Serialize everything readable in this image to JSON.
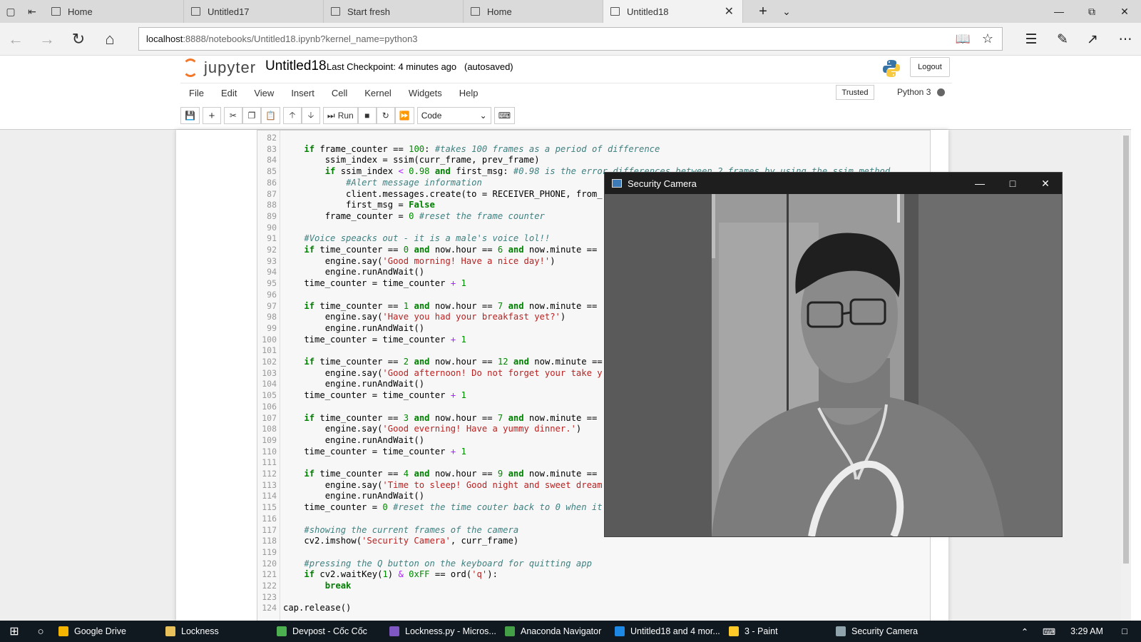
{
  "browser": {
    "tabs": [
      {
        "label": "Home"
      },
      {
        "label": "Untitled17"
      },
      {
        "label": "Start fresh"
      },
      {
        "label": "Home"
      },
      {
        "label": "Untitled18",
        "active": true
      }
    ],
    "url_host": "localhost",
    "url_rest": ":8888/notebooks/Untitled18.ipynb?kernel_name=python3"
  },
  "jupyter": {
    "logo_text": "jupyter",
    "notebook_name": "Untitled18",
    "checkpoint_label": "Last Checkpoint:",
    "checkpoint_time": "4 minutes ago",
    "autosave": "(autosaved)",
    "logout_label": "Logout",
    "menu": [
      "File",
      "Edit",
      "View",
      "Insert",
      "Cell",
      "Kernel",
      "Widgets",
      "Help"
    ],
    "trusted_label": "Trusted",
    "kernel_name": "Python 3",
    "run_label": "Run",
    "cell_type": "Code"
  },
  "code_lines": [
    {
      "n": "82",
      "t": ""
    },
    {
      "n": "83",
      "t": "    if frame_counter == 100: #takes 100 frames as a period of difference"
    },
    {
      "n": "84",
      "t": "        ssim_index = ssim(curr_frame, prev_frame)"
    },
    {
      "n": "85",
      "t": "        if ssim_index < 0.98 and first_msg: #0.98 is the error differences between 2 frames by using the ssim method"
    },
    {
      "n": "86",
      "t": "            #Alert message information"
    },
    {
      "n": "87",
      "t": "            client.messages.create(to = RECEIVER_PHONE, from_"
    },
    {
      "n": "88",
      "t": "            first_msg = False"
    },
    {
      "n": "89",
      "t": "        frame_counter = 0 #reset the frame counter"
    },
    {
      "n": "90",
      "t": ""
    },
    {
      "n": "91",
      "t": "    #Voice speacks out - it is a male's voice lol!!"
    },
    {
      "n": "92",
      "t": "    if time_counter == 0 and now.hour == 6 and now.minute =="
    },
    {
      "n": "93",
      "t": "        engine.say('Good morning! Have a nice day!')"
    },
    {
      "n": "94",
      "t": "        engine.runAndWait()"
    },
    {
      "n": "95",
      "t": "    time_counter = time_counter + 1"
    },
    {
      "n": "96",
      "t": ""
    },
    {
      "n": "97",
      "t": "    if time_counter == 1 and now.hour == 7 and now.minute =="
    },
    {
      "n": "98",
      "t": "        engine.say('Have you had your breakfast yet?')"
    },
    {
      "n": "99",
      "t": "        engine.runAndWait()"
    },
    {
      "n": "100",
      "t": "    time_counter = time_counter + 1"
    },
    {
      "n": "101",
      "t": ""
    },
    {
      "n": "102",
      "t": "    if time_counter == 2 and now.hour == 12 and now.minute =="
    },
    {
      "n": "103",
      "t": "        engine.say('Good afternoon! Do not forget your take y"
    },
    {
      "n": "104",
      "t": "        engine.runAndWait()"
    },
    {
      "n": "105",
      "t": "    time_counter = time_counter + 1"
    },
    {
      "n": "106",
      "t": ""
    },
    {
      "n": "107",
      "t": "    if time_counter == 3 and now.hour == 7 and now.minute =="
    },
    {
      "n": "108",
      "t": "        engine.say('Good everning! Have a yummy dinner.')"
    },
    {
      "n": "109",
      "t": "        engine.runAndWait()"
    },
    {
      "n": "110",
      "t": "    time_counter = time_counter + 1"
    },
    {
      "n": "111",
      "t": ""
    },
    {
      "n": "112",
      "t": "    if time_counter == 4 and now.hour == 9 and now.minute =="
    },
    {
      "n": "113",
      "t": "        engine.say('Time to sleep! Good night and sweet dream"
    },
    {
      "n": "114",
      "t": "        engine.runAndWait()"
    },
    {
      "n": "115",
      "t": "    time_counter = 0 #reset the time couter back to 0 when it"
    },
    {
      "n": "116",
      "t": ""
    },
    {
      "n": "117",
      "t": "    #showing the current frames of the camera"
    },
    {
      "n": "118",
      "t": "    cv2.imshow('Security Camera', curr_frame)"
    },
    {
      "n": "119",
      "t": ""
    },
    {
      "n": "120",
      "t": "    #pressing the Q button on the keyboard for quitting app"
    },
    {
      "n": "121",
      "t": "    if cv2.waitKey(1) & 0xFF == ord('q'):"
    },
    {
      "n": "122",
      "t": "        break"
    },
    {
      "n": "123",
      "t": ""
    },
    {
      "n": "124",
      "t": "cap.release()"
    }
  ],
  "camera_window": {
    "title": "Security Camera"
  },
  "taskbar": {
    "items": [
      {
        "label": "Google Drive",
        "color": "#f4b400"
      },
      {
        "label": "Lockness",
        "color": "#e8c15a"
      },
      {
        "label": "Devpost - Cốc Cốc",
        "color": "#4caf50"
      },
      {
        "label": "Lockness.py - Micros...",
        "color": "#7e57c2"
      },
      {
        "label": "Anaconda Navigator",
        "color": "#43a047"
      },
      {
        "label": "Untitled18 and 4 mor...",
        "color": "#1e88e5"
      },
      {
        "label": "3 - Paint",
        "color": "#ffca28"
      },
      {
        "label": "Security Camera",
        "color": "#90a4ae"
      }
    ],
    "clock": "3:29 AM"
  }
}
